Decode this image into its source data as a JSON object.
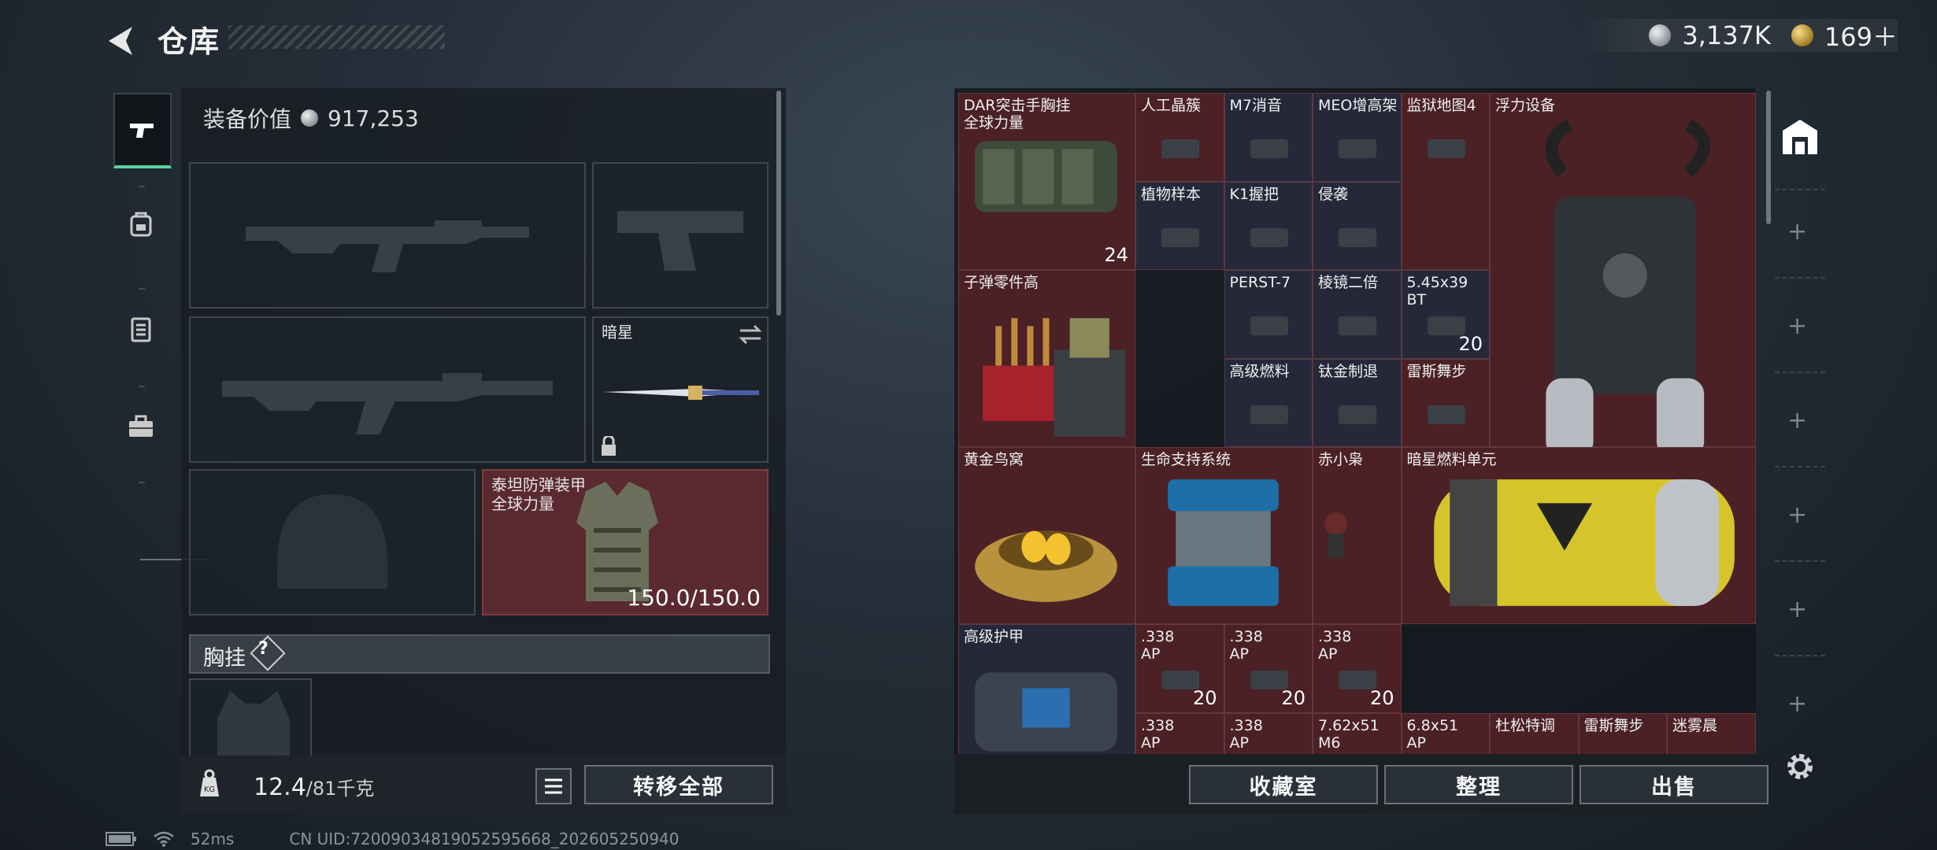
{
  "header": {
    "title": "仓库"
  },
  "currency": {
    "silver": "3,137K",
    "gold": "169＋"
  },
  "left_panel": {
    "equipment_value_label": "装备价值",
    "equipment_value": "917,253",
    "melee_name": "暗星",
    "armor_name": "泰坦防弹装甲\n全球力量",
    "armor_durability": "150.0/150.0",
    "chest_rig_label": "胸挂",
    "chest_rig_help": "?",
    "weight_current": "12.4",
    "weight_max": "/81千克",
    "transfer_all": "转移全部"
  },
  "grid_items": [
    {
      "label": "DAR突击手胸挂\n全球力量",
      "count": "24",
      "color": "red"
    },
    {
      "label": "人工晶簇",
      "count": "",
      "color": "red"
    },
    {
      "label": "M7消音",
      "count": "",
      "color": "blue"
    },
    {
      "label": "MEO增高架",
      "count": "",
      "color": "blue"
    },
    {
      "label": "监狱地图4",
      "count": "",
      "color": "red"
    },
    {
      "label": "浮力设备",
      "count": "",
      "color": "red"
    },
    {
      "label": "植物样本",
      "count": "",
      "color": "blue"
    },
    {
      "label": "K1握把",
      "count": "",
      "color": "blue"
    },
    {
      "label": "侵袭",
      "count": "",
      "color": "blue"
    },
    {
      "label": "子弹零件高",
      "count": "",
      "color": "red"
    },
    {
      "label": "PERST-7",
      "count": "",
      "color": "blue"
    },
    {
      "label": "棱镜二倍",
      "count": "",
      "color": "blue"
    },
    {
      "label": "5.45x39\nBT",
      "count": "20",
      "color": "blue"
    },
    {
      "label": "高级燃料",
      "count": "",
      "color": "blue"
    },
    {
      "label": "钛金制退",
      "count": "",
      "color": "blue"
    },
    {
      "label": "雷斯舞步",
      "count": "",
      "color": "red"
    },
    {
      "label": "黄金鸟窝",
      "count": "",
      "color": "red"
    },
    {
      "label": "生命支持系统",
      "count": "",
      "color": "red"
    },
    {
      "label": "赤小枭",
      "count": "",
      "color": "red"
    },
    {
      "label": "暗星燃料单元",
      "count": "",
      "color": "red"
    },
    {
      "label": "高级护甲",
      "count": "",
      "color": "blue"
    },
    {
      "label": ".338\nAP",
      "count": "20",
      "color": "red"
    },
    {
      "label": ".338\nAP",
      "count": "20",
      "color": "red"
    },
    {
      "label": ".338\nAP",
      "count": "20",
      "color": "red"
    },
    {
      "label": ".338\nAP",
      "count": "",
      "color": "red"
    },
    {
      "label": ".338\nAP",
      "count": "",
      "color": "red"
    },
    {
      "label": "7.62x51\nM6",
      "count": "",
      "color": "red"
    },
    {
      "label": "6.8x51\nAP",
      "count": "",
      "color": "red"
    },
    {
      "label": "杜松特调",
      "count": "",
      "color": "red"
    },
    {
      "label": "雷斯舞步",
      "count": "",
      "color": "red"
    },
    {
      "label": "迷雾晨",
      "count": "",
      "color": "red"
    }
  ],
  "buttons": {
    "collection": "收藏室",
    "organize": "整理",
    "sell": "出售"
  },
  "status_bar": {
    "ping": "52ms",
    "uid": "CN UID:72009034819052595668_202605250940"
  }
}
